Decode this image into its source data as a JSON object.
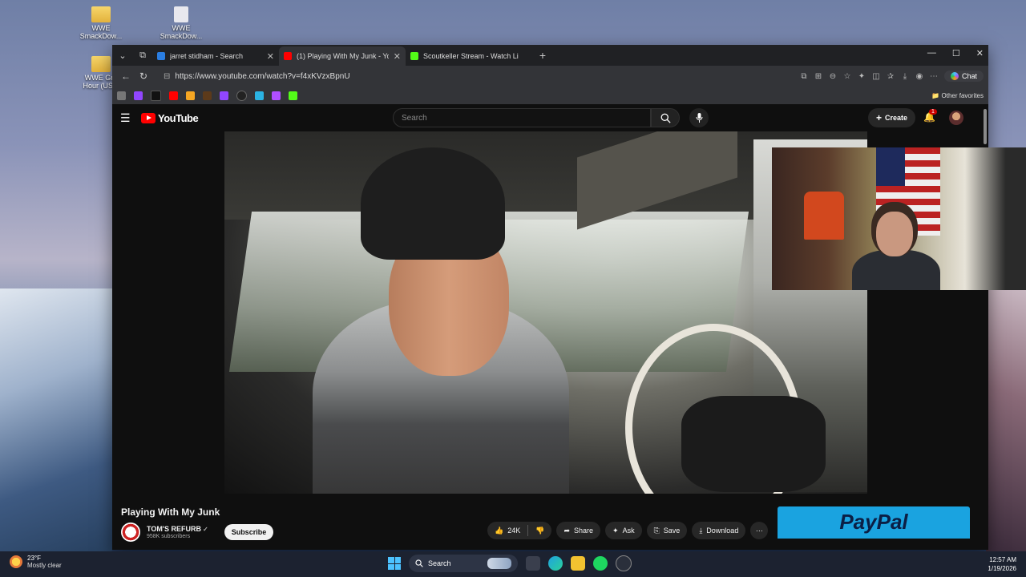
{
  "desktop": {
    "icons": [
      {
        "label": "WWE SmackDow..."
      },
      {
        "label": "WWE SmackDow..."
      },
      {
        "label": "WWE Gru Hour (US..."
      }
    ]
  },
  "browser": {
    "tabs": [
      {
        "title": "jarret stidham - Search",
        "active": false
      },
      {
        "title": "(1) Playing With My Junk - Yo",
        "active": true
      },
      {
        "title": "Scoutkeller Stream - Watch Li",
        "active": false
      }
    ],
    "url": "https://www.youtube.com/watch?v=f4xKVzxBpnU",
    "chat_label": "Chat",
    "other_favorites": "Other favorites"
  },
  "youtube": {
    "logo_text": "YouTube",
    "search_placeholder": "Search",
    "create_label": "Create",
    "notif_count": "1",
    "video_title": "Playing With My Junk",
    "channel": {
      "name": "TOM'S REFURB",
      "verified": "✓",
      "subscribers": "958K subscribers"
    },
    "subscribe_label": "Subscribe",
    "actions": {
      "likes": "24K",
      "share": "Share",
      "ask": "Ask",
      "save": "Save",
      "download": "Download"
    },
    "ad_brand": "PayPal"
  },
  "taskbar": {
    "temp": "23°F",
    "weather": "Mostly clear",
    "search_label": "Search",
    "time": "12:57 AM",
    "date": "1/19/2026"
  },
  "colors": {
    "youtube_red": "#ff0000",
    "paypal_bg": "#1aa3e0"
  }
}
